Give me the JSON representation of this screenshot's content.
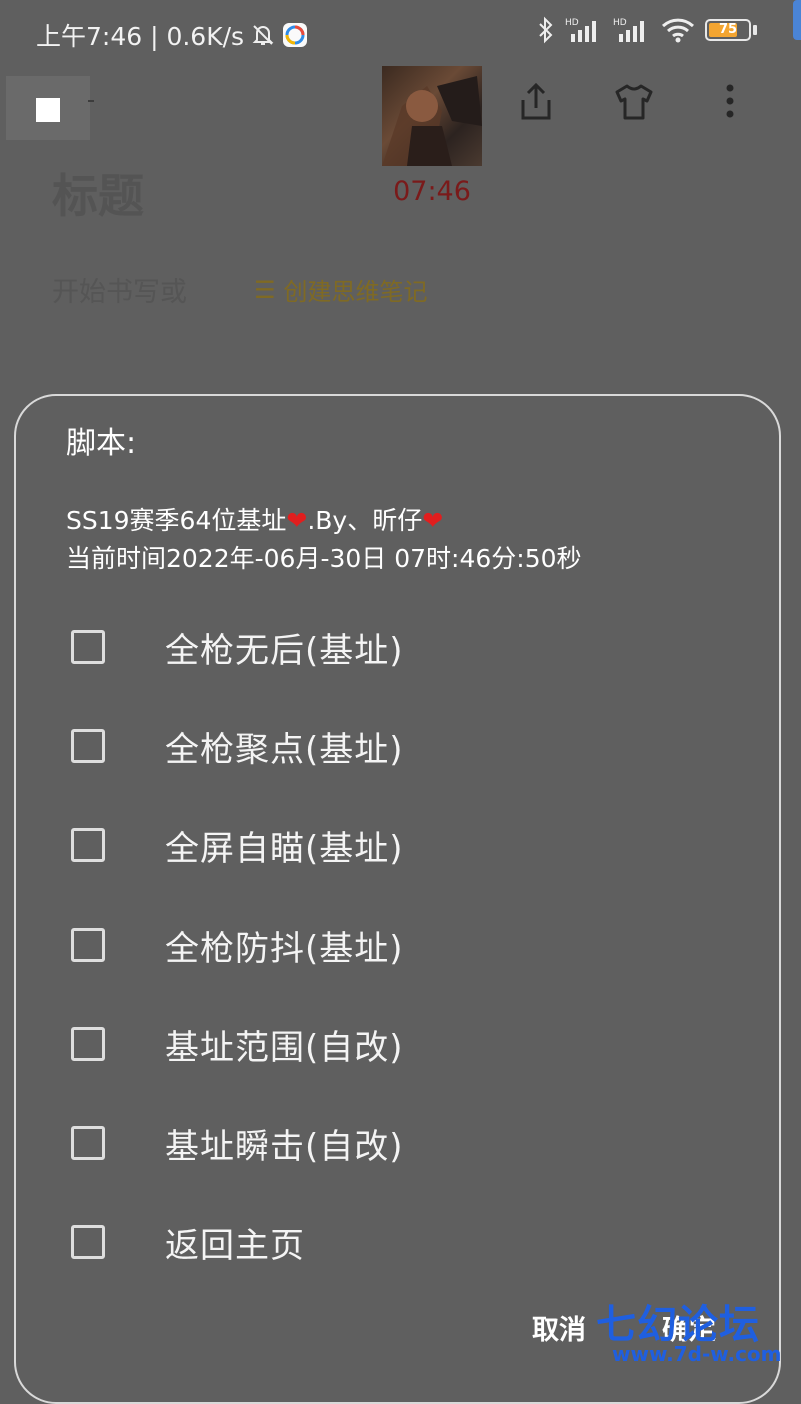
{
  "status_bar": {
    "time_speed": "上午7:46 | 0.6K/s",
    "battery": "75",
    "battery_level_pct": 75,
    "icons": [
      "mute-bell-icon",
      "browser-app-icon",
      "bluetooth-icon",
      "hd-signal-icon",
      "hd-signal-icon",
      "wifi-icon",
      "battery-icon"
    ]
  },
  "header": {
    "cover_time": "07:46",
    "title": "标题",
    "hint": "开始书写或",
    "mind_note_icon": "☰",
    "mind_note": "创建思维笔记",
    "icons": [
      "back-icon",
      "share-icon",
      "shirt-icon",
      "more-vert-icon"
    ]
  },
  "dialog": {
    "title": "脚本:",
    "message_line1_a": "SS19赛季64位基址",
    "message_line1_b": ".By、昕仔",
    "message_line2": "当前时间2022年-06月-30日 07时:46分:50秒",
    "heart": "❤",
    "options": [
      {
        "label": "全枪无后(基址)",
        "checked": false
      },
      {
        "label": "全枪聚点(基址)",
        "checked": false
      },
      {
        "label": "全屏自瞄(基址)",
        "checked": false
      },
      {
        "label": "全枪防抖(基址)",
        "checked": false
      },
      {
        "label": "基址范围(自改)",
        "checked": false
      },
      {
        "label": "基址瞬击(自改)",
        "checked": false
      },
      {
        "label": "返回主页",
        "checked": false
      }
    ],
    "cancel": "取消",
    "confirm": "确定"
  },
  "watermark": {
    "title": "七幻论坛",
    "url": "www.7d-w.com"
  },
  "colors": {
    "background": "#5f5f5f",
    "dialog_border": "#d9d9d9",
    "heart": "#e11e1e",
    "watermark": "#1f5fe0",
    "cover_time": "#7a1a1a"
  }
}
